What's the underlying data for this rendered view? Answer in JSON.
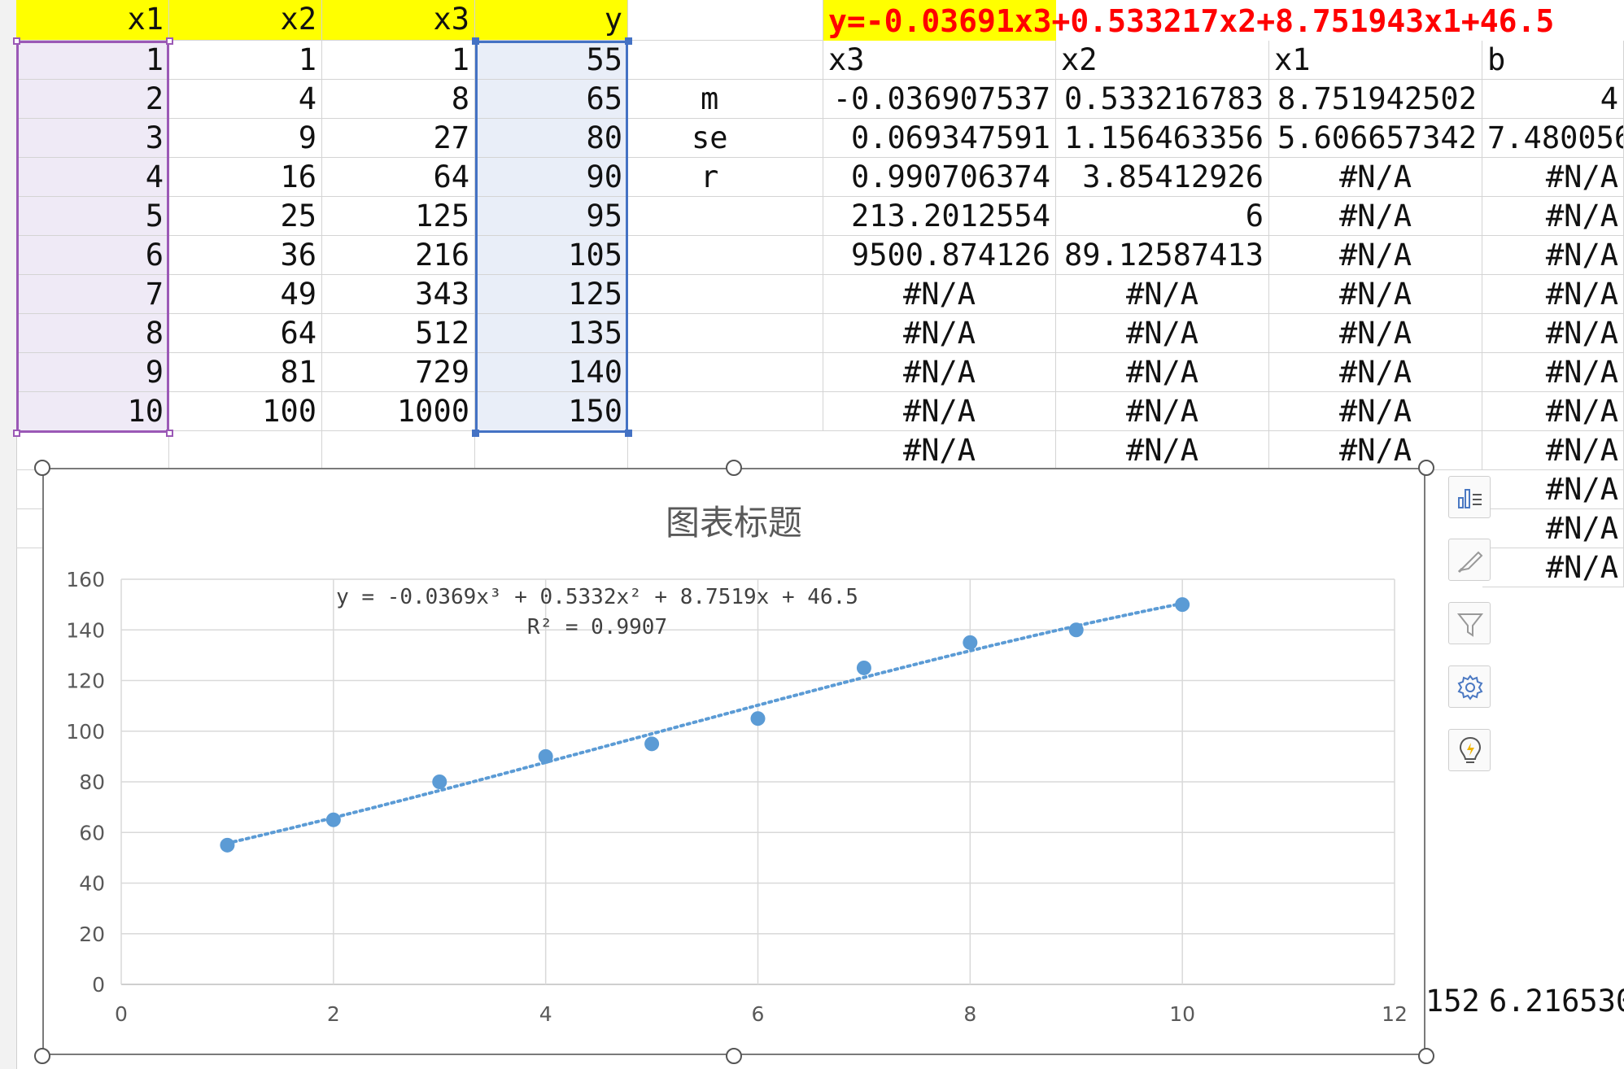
{
  "formula_text": "y=-0.03691x3+0.533217x2+8.751943x1+46.5",
  "headers": {
    "x1": "x1",
    "x2": "x2",
    "x3": "x3",
    "y": "y"
  },
  "rows": [
    {
      "x1": "1",
      "x2": "1",
      "x3": "1",
      "y": "55"
    },
    {
      "x1": "2",
      "x2": "4",
      "x3": "8",
      "y": "65"
    },
    {
      "x1": "3",
      "x2": "9",
      "x3": "27",
      "y": "80"
    },
    {
      "x1": "4",
      "x2": "16",
      "x3": "64",
      "y": "90"
    },
    {
      "x1": "5",
      "x2": "25",
      "x3": "125",
      "y": "95"
    },
    {
      "x1": "6",
      "x2": "36",
      "x3": "216",
      "y": "105"
    },
    {
      "x1": "7",
      "x2": "49",
      "x3": "343",
      "y": "125"
    },
    {
      "x1": "8",
      "x2": "64",
      "x3": "512",
      "y": "135"
    },
    {
      "x1": "9",
      "x2": "81",
      "x3": "729",
      "y": "140"
    },
    {
      "x1": "10",
      "x2": "100",
      "x3": "1000",
      "y": "150"
    }
  ],
  "linest": {
    "col_headers": [
      "x3",
      "x2",
      "x1",
      "b"
    ],
    "row_labels": [
      "m",
      "se",
      "r"
    ],
    "rows": [
      [
        "-0.036907537",
        "0.533216783",
        "8.751942502",
        "4"
      ],
      [
        "0.069347591",
        "1.156463356",
        "5.606657342",
        "7.480056"
      ],
      [
        "0.990706374",
        "3.85412926",
        "#N/A",
        "#N/A"
      ],
      [
        "213.2012554",
        "6",
        "#N/A",
        "#N/A"
      ],
      [
        "9500.874126",
        "89.12587413",
        "#N/A",
        "#N/A"
      ],
      [
        "#N/A",
        "#N/A",
        "#N/A",
        "#N/A"
      ],
      [
        "#N/A",
        "#N/A",
        "#N/A",
        "#N/A"
      ],
      [
        "#N/A",
        "#N/A",
        "#N/A",
        "#N/A"
      ],
      [
        "#N/A",
        "#N/A",
        "#N/A",
        "#N/A"
      ],
      [
        "#N/A",
        "#N/A",
        "#N/A",
        "#N/A"
      ]
    ],
    "extra_b": [
      "#N/A",
      "#N/A",
      "#N/A"
    ]
  },
  "bottom_values": {
    "left": "152",
    "right": "6.216530"
  },
  "chart_data": {
    "type": "scatter",
    "title": "图表标题",
    "x": [
      1,
      2,
      3,
      4,
      5,
      6,
      7,
      8,
      9,
      10
    ],
    "y": [
      55,
      65,
      80,
      90,
      95,
      105,
      125,
      135,
      140,
      150
    ],
    "xlim": [
      0,
      12
    ],
    "ylim": [
      0,
      160
    ],
    "xticks": [
      "0",
      "2",
      "4",
      "6",
      "8",
      "10",
      "12"
    ],
    "yticks": [
      "0",
      "20",
      "40",
      "60",
      "80",
      "100",
      "120",
      "140",
      "160"
    ],
    "trendline": {
      "type": "polynomial",
      "order": 3,
      "coefficients": [
        -0.0369,
        0.5332,
        8.7519,
        46.5
      ]
    },
    "equation": "y = -0.0369x³ + 0.5332x² + 8.7519x + 46.5",
    "r_squared": "R² = 0.9907",
    "grid": true,
    "legend": "none",
    "marker_color": "#5b9bd5"
  },
  "side_tools": [
    "chart-elements-icon",
    "chart-style-icon",
    "chart-filter-icon",
    "chart-settings-icon",
    "chart-ideas-icon"
  ]
}
